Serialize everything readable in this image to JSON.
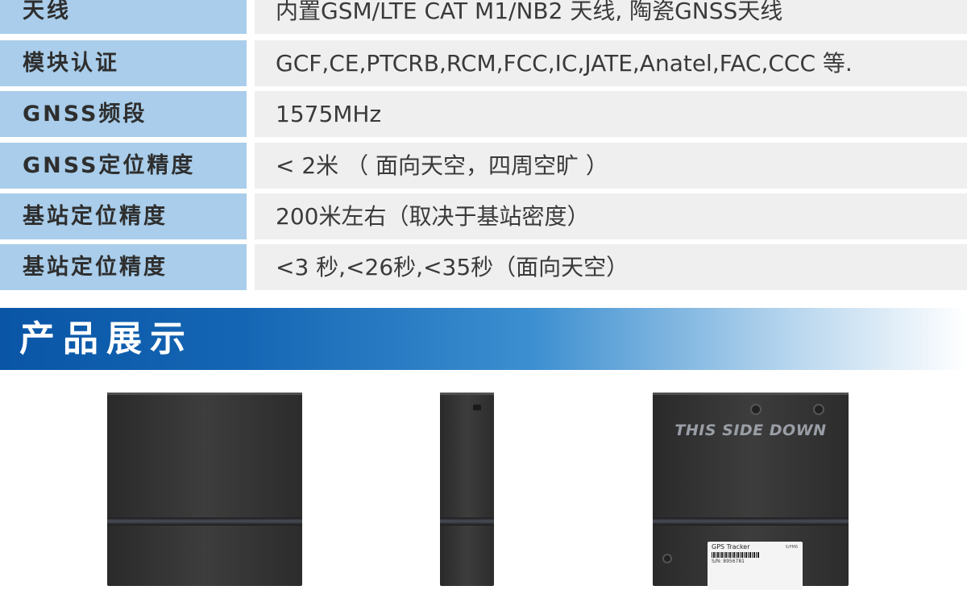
{
  "specs": [
    {
      "label": "天线",
      "value": "内置GSM/LTE CAT M1/NB2 天线, 陶瓷GNSS天线"
    },
    {
      "label": "模块认证",
      "value": "GCF,CE,PTCRB,RCM,FCC,IC,JATE,Anatel,FAC,CCC 等."
    },
    {
      "label": "GNSS频段",
      "value": "1575MHz"
    },
    {
      "label": "GNSS定位精度",
      "value": "< 2米 （ 面向天空，四周空旷 ）"
    },
    {
      "label": "基站定位精度",
      "value": "200米左右（取决于基站密度）"
    },
    {
      "label": "基站定位精度",
      "value": "<3 秒,<26秒,<35秒（面向天空）"
    }
  ],
  "section": {
    "title": "产品展示"
  },
  "products": {
    "back_text": "THIS SIDE DOWN",
    "label_title": "GPS Tracker",
    "label_model": "S/PM6",
    "label_sn": "S/N: 8956781"
  },
  "colors": {
    "label_bg": "#a9cdea",
    "value_bg": "#efefef",
    "header_blue": "#0a55a6"
  }
}
